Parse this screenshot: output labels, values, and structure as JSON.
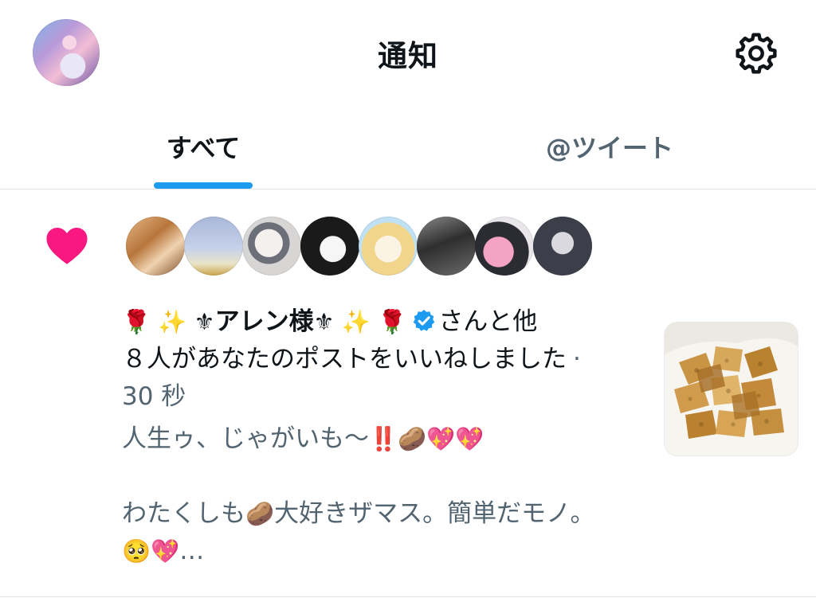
{
  "header": {
    "title": "通知",
    "avatar_icon": "user-avatar",
    "settings_icon": "gear-icon"
  },
  "tabs": [
    {
      "label": "すべて",
      "active": true
    },
    {
      "label": "@ツイート",
      "active": false
    }
  ],
  "colors": {
    "accent": "#1d9bf0",
    "like": "#f91880",
    "text_primary": "#0f1419",
    "text_secondary": "#536471"
  },
  "notification": {
    "type_icon": "heart-icon",
    "liker_count_shown": 8,
    "name_prefix": "🌹 ✨ ⚜",
    "name": "アレン様",
    "name_suffix": "⚜ ✨ 🌹",
    "verified_icon": "verified-badge-icon",
    "after_name": "さんと他",
    "line2": "８人があなたのポストをいいねしました",
    "time": "30 秒",
    "post_line1": "人生ゥ、じゃがいも〜",
    "post_line1_emoji": "‼️🥔💖💖",
    "post_line3_a": "わたくしも",
    "post_line3_emoji": "🥔",
    "post_line3_b": "大好きザマス。簡単だモノ。",
    "post_line4_emoji": "🥺💖",
    "ellipsis": "…",
    "thumbnail_icon": "post-image-fried-potatoes"
  }
}
